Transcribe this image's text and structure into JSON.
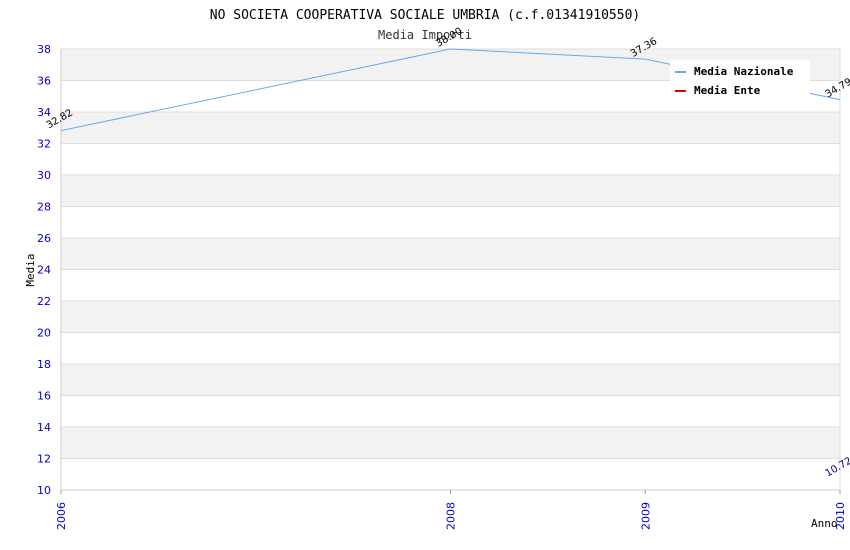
{
  "chart_data": {
    "type": "line",
    "title": "NO SOCIETA COOPERATIVA SOCIALE UMBRIA (c.f.01341910550)",
    "subtitle": "Media Importi",
    "xlabel": "Anno",
    "ylabel": "Media",
    "x": [
      "2006",
      "2008",
      "2009",
      "2010"
    ],
    "ylim": [
      10,
      38
    ],
    "yticks": [
      10,
      12,
      14,
      16,
      18,
      20,
      22,
      24,
      26,
      28,
      30,
      32,
      34,
      36,
      38
    ],
    "grid": true,
    "legend_position": "top-right",
    "series": [
      {
        "name": "Media Nazionale",
        "color": "#66aaee",
        "values": [
          32.82,
          38.0,
          37.36,
          34.79
        ],
        "labels": [
          "32.82",
          "38.00",
          "37.36",
          "34.79"
        ]
      },
      {
        "name": "Media Ente",
        "color": "#dd0000",
        "values": [
          null,
          null,
          null,
          10.72
        ],
        "labels": [
          "",
          "",
          "",
          "10.72"
        ]
      }
    ]
  }
}
